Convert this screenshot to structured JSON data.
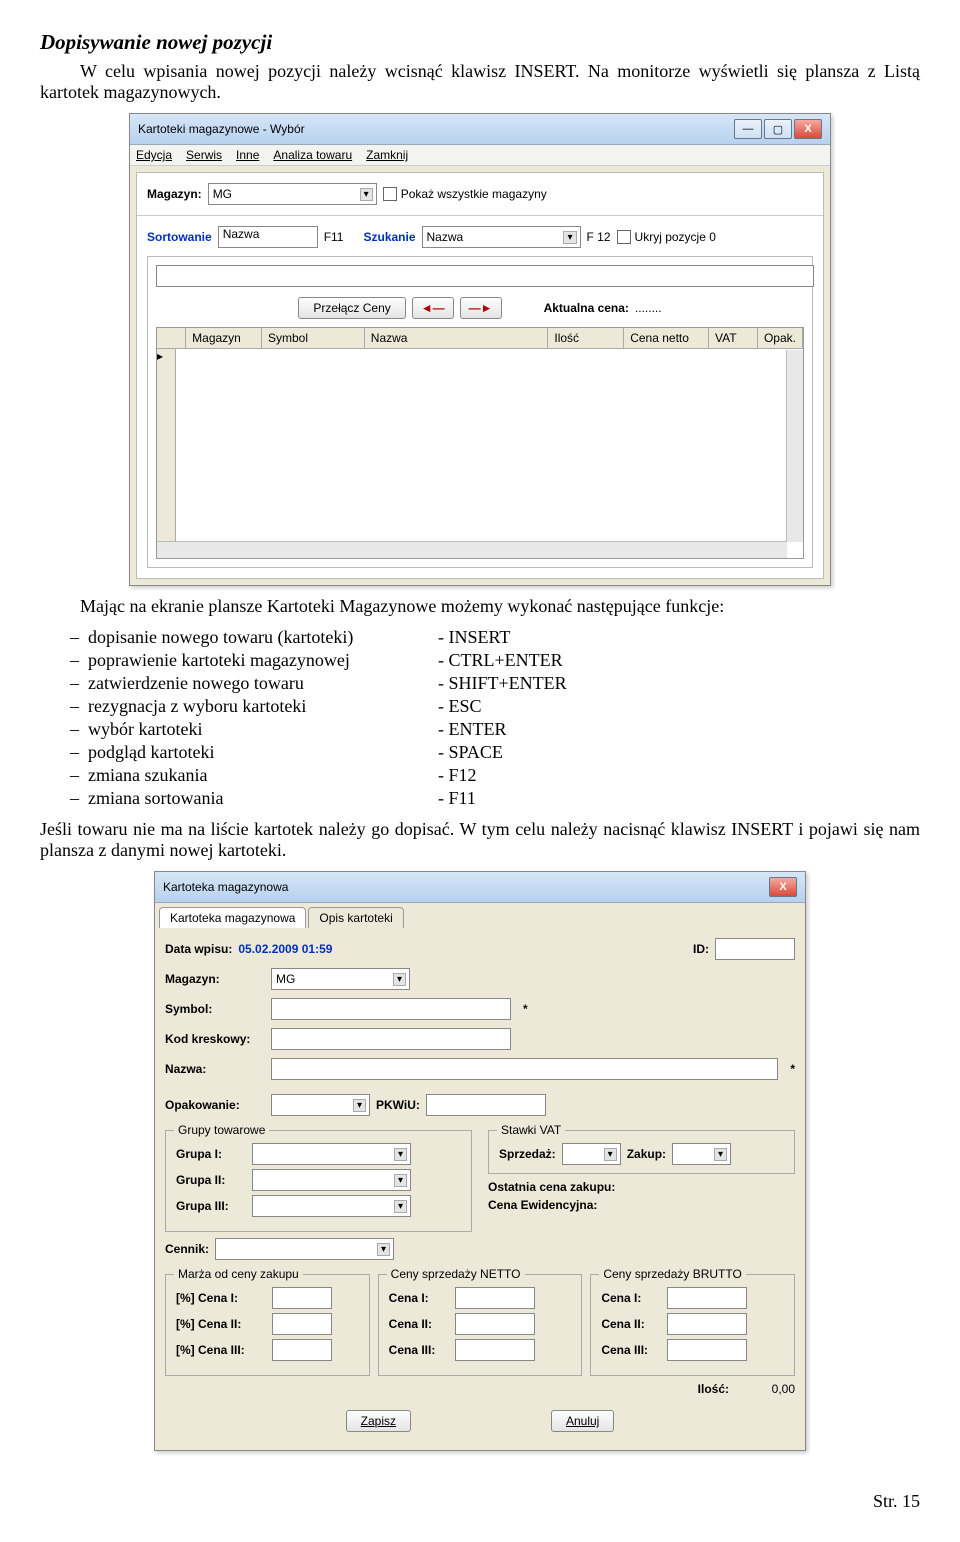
{
  "heading": "Dopisywanie nowej pozycji",
  "intro": "W celu wpisania nowej pozycji należy wcisnąć klawisz INSERT. Na monitorze wyświetli się plansza z Listą kartotek magazynowych.",
  "win1": {
    "title": "Kartoteki magazynowe  - Wybór",
    "menu": [
      "Edycja",
      "Serwis",
      "Inne",
      "Analiza towaru",
      "Zamknij"
    ],
    "magazyn_label": "Magazyn:",
    "magazyn_value": "MG",
    "show_all_label": "Pokaż wszystkie magazyny",
    "sort_label": "Sortowanie",
    "sort_value": "Nazwa",
    "f11": "F11",
    "szukanie_label": "Szukanie",
    "szukanie_value": "Nazwa",
    "f12": "F 12",
    "hide_zero_label": "Ukryj pozycje 0",
    "switch_prices": "Przełącz Ceny",
    "current_price_label": "Aktualna cena:",
    "current_price_value": "........",
    "cols": [
      "Magazyn",
      "Symbol",
      "Nazwa",
      "Ilość",
      "Cena netto",
      "VAT",
      "Opak."
    ]
  },
  "funcs_intro": "Mając na ekranie plansze Kartoteki Magazynowe możemy wykonać następujące funkcje:",
  "funcs": [
    {
      "l": "dopisanie nowego towaru (kartoteki)",
      "r": "- INSERT"
    },
    {
      "l": "poprawienie kartoteki magazynowej",
      "r": "- CTRL+ENTER"
    },
    {
      "l": "zatwierdzenie nowego towaru",
      "r": "- SHIFT+ENTER"
    },
    {
      "l": "rezygnacja z wyboru kartoteki",
      "r": "- ESC"
    },
    {
      "l": "wybór kartoteki",
      "r": "- ENTER"
    },
    {
      "l": "podgląd kartoteki",
      "r": "- SPACE"
    },
    {
      "l": "zmiana szukania",
      "r": "- F12"
    },
    {
      "l": "zmiana sortowania",
      "r": "- F11"
    }
  ],
  "para2": "Jeśli towaru nie ma na liście kartotek należy go dopisać. W tym celu należy nacisnąć klawisz INSERT i pojawi się nam plansza z danymi nowej kartoteki.",
  "win2": {
    "title": "Kartoteka magazynowa",
    "tabs": [
      "Kartoteka magazynowa",
      "Opis kartoteki"
    ],
    "data_wpisu_label": "Data wpisu:",
    "data_wpisu_value": "05.02.2009 01:59",
    "id_label": "ID:",
    "magazyn_label": "Magazyn:",
    "magazyn_value": "MG",
    "symbol_label": "Symbol:",
    "kod_label": "Kod kreskowy:",
    "nazwa_label": "Nazwa:",
    "opak_label": "Opakowanie:",
    "pkwiu_label": "PKWiU:",
    "grupy_title": "Grupy towarowe",
    "g1": "Grupa I:",
    "g2": "Grupa II:",
    "g3": "Grupa III:",
    "vat_title": "Stawki VAT",
    "sprzedaz_label": "Sprzedaż:",
    "zakup_label": "Zakup:",
    "ost_cena_label": "Ostatnia cena zakupu:",
    "cena_ew_label": "Cena Ewidencyjna:",
    "cennik_label": "Cennik:",
    "marza_title": "Marża od ceny zakupu",
    "netto_title": "Ceny sprzedaży NETTO",
    "brutto_title": "Ceny sprzedaży BRUTTO",
    "pct_cena1": "[%]   Cena I:",
    "pct_cena2": "[%]   Cena II:",
    "pct_cena3": "[%]   Cena III:",
    "cena1": "Cena I:",
    "cena2": "Cena II:",
    "cena3": "Cena III:",
    "ilosc_label": "Ilość:",
    "ilosc_value": "0,00",
    "zapisz": "Zapisz",
    "anuluj": "Anuluj"
  },
  "footer": "Str. 15"
}
